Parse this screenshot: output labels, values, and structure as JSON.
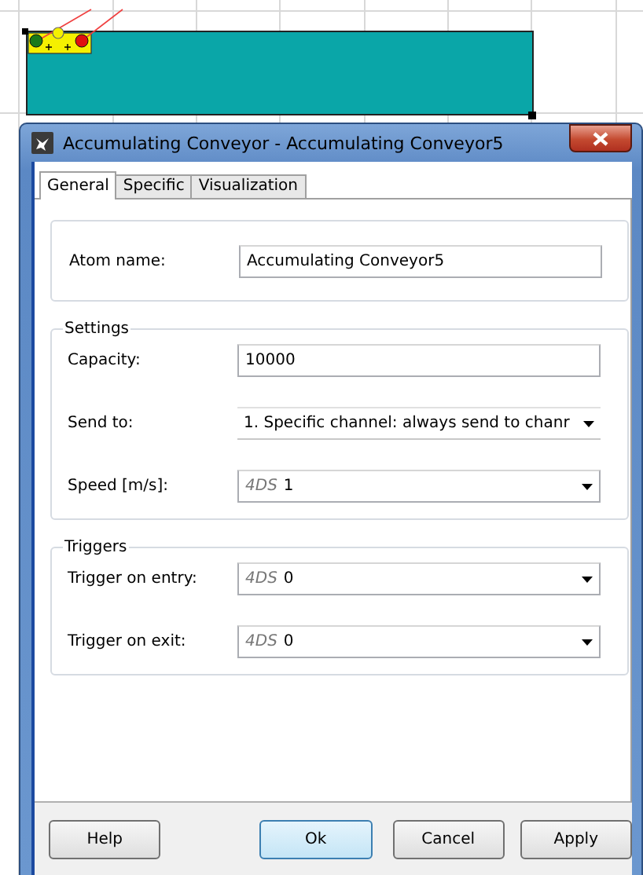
{
  "dialog": {
    "title": "Accumulating Conveyor - Accumulating Conveyor5",
    "tabs": [
      {
        "label": "General",
        "selected": true
      },
      {
        "label": "Specific",
        "selected": false
      },
      {
        "label": "Visualization",
        "selected": false
      }
    ],
    "atom_name": {
      "label": "Atom name:",
      "value": "Accumulating Conveyor5"
    },
    "groups": [
      {
        "title": "Settings",
        "fields": [
          {
            "kind": "text",
            "label": "Capacity:",
            "value": "10000"
          },
          {
            "kind": "dropdown",
            "label": "Send to:",
            "value": "1. Specific channel: always send to chanr"
          },
          {
            "kind": "expression",
            "label": "Speed [m/s]:",
            "prefix": "4DS",
            "value": "1"
          }
        ]
      },
      {
        "title": "Triggers",
        "fields": [
          {
            "kind": "expression",
            "label": "Trigger on entry:",
            "prefix": "4DS",
            "value": "0"
          },
          {
            "kind": "expression",
            "label": "Trigger on exit:",
            "prefix": "4DS",
            "value": "0"
          }
        ]
      }
    ],
    "buttons": [
      {
        "label": "Help",
        "focused": false
      },
      {
        "label": "Ok",
        "focused": true
      },
      {
        "label": "Cancel",
        "focused": false
      },
      {
        "label": "Apply",
        "focused": false
      }
    ]
  }
}
